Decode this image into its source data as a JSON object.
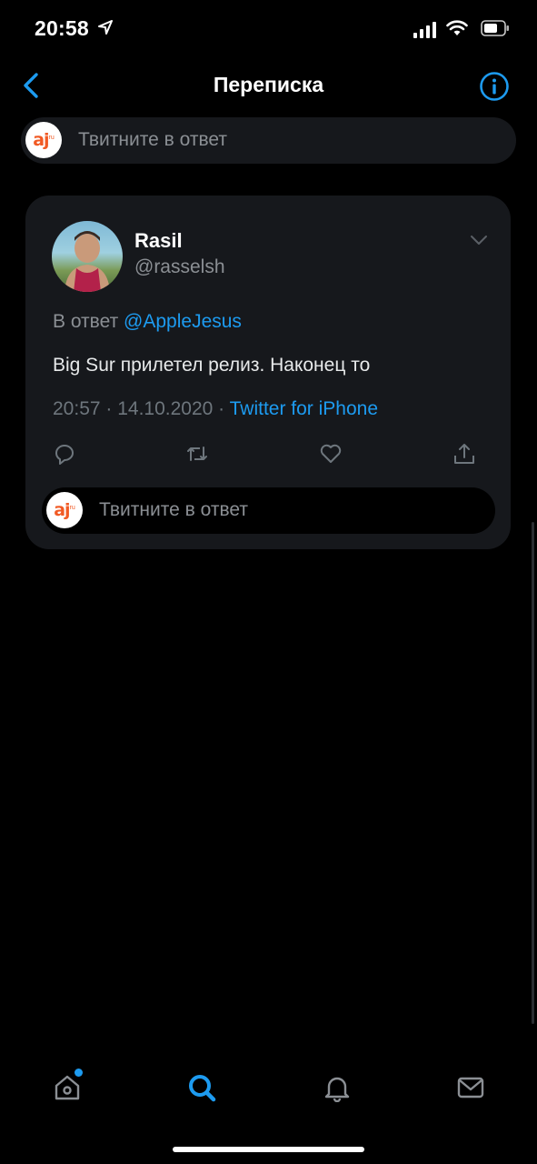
{
  "status_bar": {
    "time": "20:58"
  },
  "nav": {
    "title": "Переписка"
  },
  "reply_top": {
    "placeholder": "Твитните в ответ",
    "logo_text": "aj",
    "logo_sub": "ru"
  },
  "tweet": {
    "name": "Rasil",
    "handle": "@rasselsh",
    "reply_prefix": "В ответ",
    "reply_mention": "@AppleJesus",
    "text": "Big Sur прилетел релиз. Наконец то",
    "timestamp": "20:57 · 14.10.2020 · ",
    "source": "Twitter for iPhone"
  },
  "reply_inline": {
    "placeholder": "Твитните в ответ"
  },
  "actions": [
    "reply-icon",
    "retweet-icon",
    "like-icon",
    "share-icon"
  ],
  "tabs": [
    "home-icon",
    "search-icon",
    "notifications-icon",
    "messages-icon"
  ],
  "colors": {
    "accent": "#1d9bf0",
    "background": "#000000",
    "card": "#16181c",
    "logo": "#f15a24"
  }
}
